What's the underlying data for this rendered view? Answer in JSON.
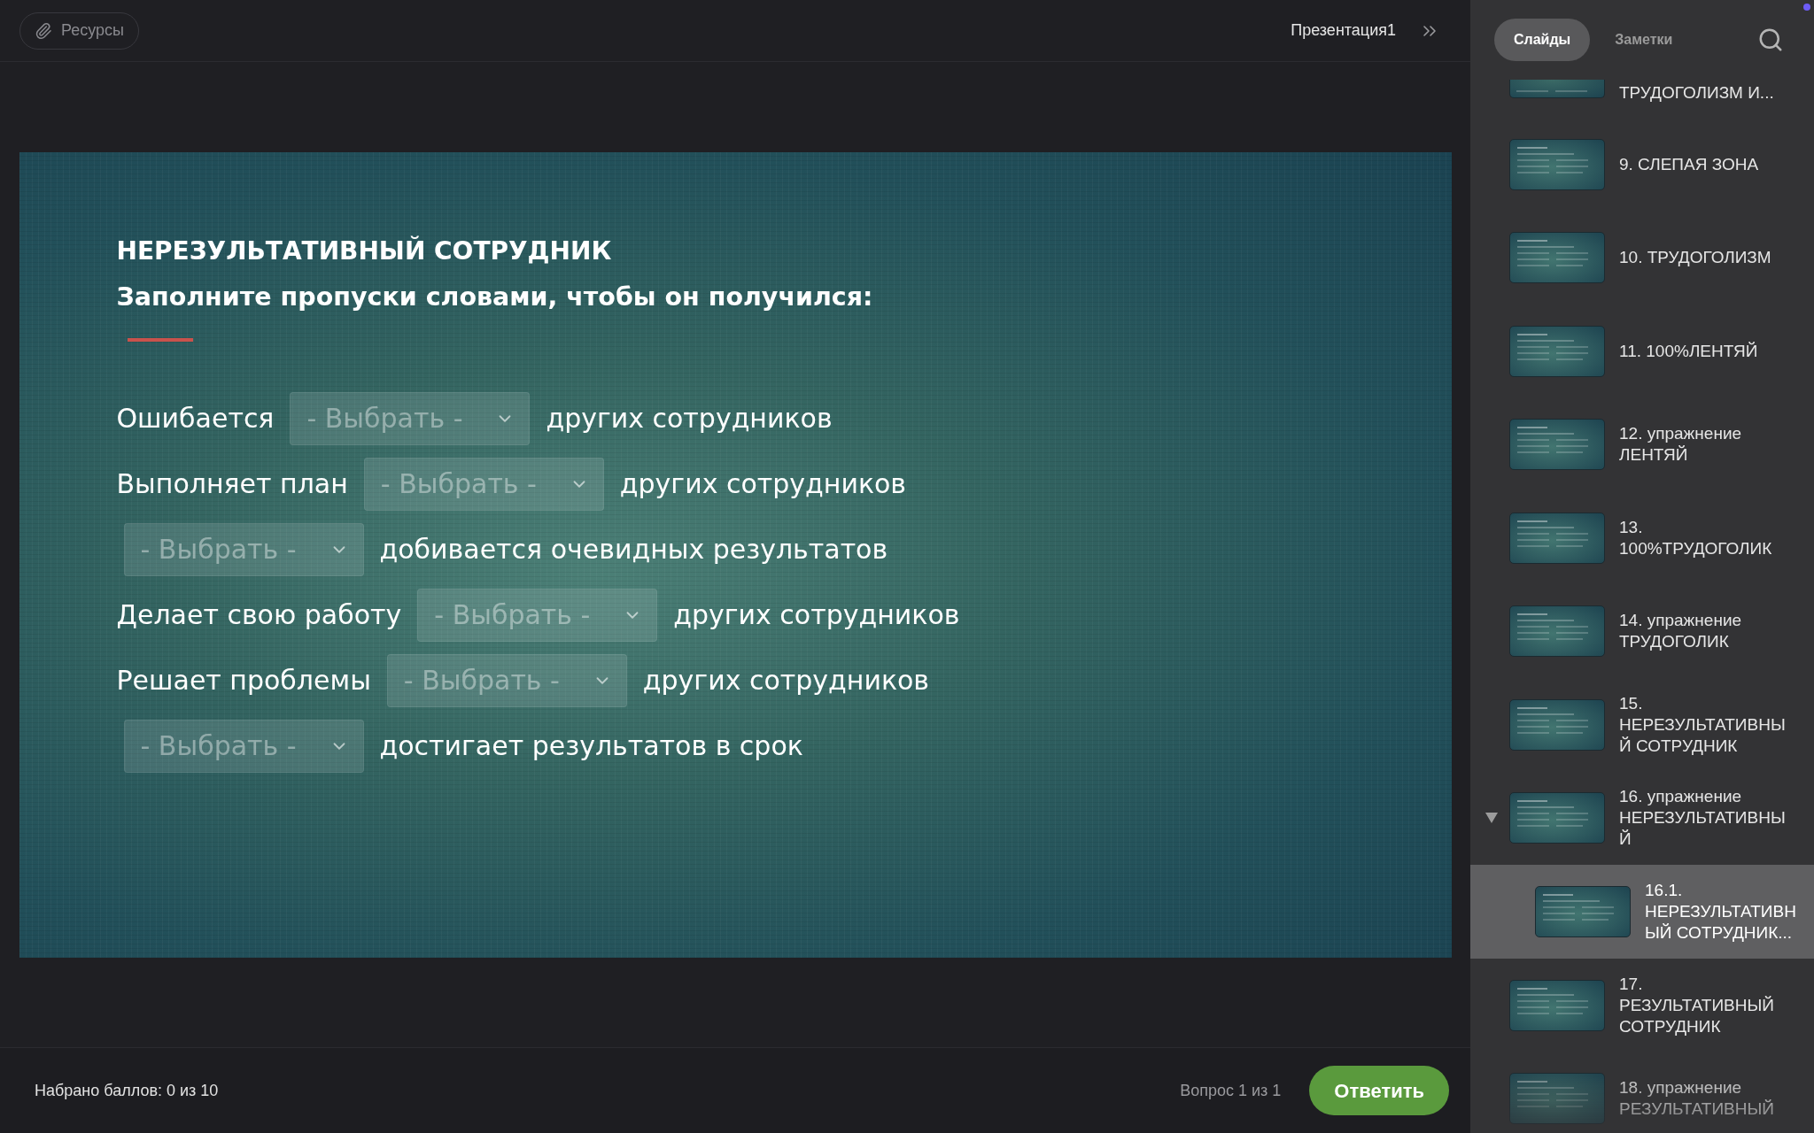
{
  "toolbar": {
    "resources_button": "Ресурсы",
    "presentation_title": "Презентация1"
  },
  "slide": {
    "title": "НЕРЕЗУЛЬТАТИВНЫЙ СОТРУДНИК",
    "subtitle": "Заполните пропуски словами, чтобы он получился:",
    "rows": [
      {
        "parts": [
          {
            "kind": "text",
            "text": "Ошибается"
          },
          {
            "kind": "select",
            "placeholder": "- Выбрать -"
          },
          {
            "kind": "text",
            "text": "других сотрудников"
          }
        ]
      },
      {
        "parts": [
          {
            "kind": "text",
            "text": "Выполняет план"
          },
          {
            "kind": "select",
            "placeholder": "- Выбрать -"
          },
          {
            "kind": "text",
            "text": "других сотрудников"
          }
        ]
      },
      {
        "parts": [
          {
            "kind": "select",
            "placeholder": "- Выбрать -"
          },
          {
            "kind": "text",
            "text": "добивается очевидных результатов"
          }
        ]
      },
      {
        "parts": [
          {
            "kind": "text",
            "text": "Делает свою работу"
          },
          {
            "kind": "select",
            "placeholder": "- Выбрать -"
          },
          {
            "kind": "text",
            "text": "других сотрудников"
          }
        ]
      },
      {
        "parts": [
          {
            "kind": "text",
            "text": "Решает проблемы"
          },
          {
            "kind": "select",
            "placeholder": "- Выбрать -"
          },
          {
            "kind": "text",
            "text": "других сотрудников"
          }
        ]
      },
      {
        "parts": [
          {
            "kind": "select",
            "placeholder": "- Выбрать -"
          },
          {
            "kind": "text",
            "text": "достигает результатов в срок"
          }
        ]
      }
    ]
  },
  "footer": {
    "score": "Набрано баллов: 0 из 10",
    "question_counter": "Вопрос 1 из 1",
    "submit_button": "Ответить"
  },
  "sidebar": {
    "tabs": [
      {
        "label": "Слайды",
        "selected": true
      },
      {
        "label": "Заметки",
        "selected": false
      }
    ],
    "slides": [
      {
        "kind": "clipped",
        "title": "ТРУДОГОЛИЗМ И...",
        "selected": false
      },
      {
        "kind": "slide",
        "title": "9. СЛЕПАЯ ЗОНА",
        "selected": false
      },
      {
        "kind": "slide",
        "title": "10. ТРУДОГОЛИЗМ",
        "selected": false
      },
      {
        "kind": "slide",
        "title": "11. 100%ЛЕНТЯЙ",
        "selected": false
      },
      {
        "kind": "slide",
        "title": "12. упражнение ЛЕНТЯЙ",
        "selected": false
      },
      {
        "kind": "slide",
        "title": "13. 100%ТРУДОГОЛИК",
        "selected": false
      },
      {
        "kind": "slide",
        "title": "14. упражнение ТРУДОГОЛИК",
        "selected": false
      },
      {
        "kind": "slide",
        "title": "15. НЕРЕЗУЛЬТАТИВНЫЙ СОТРУДНИК",
        "selected": false
      },
      {
        "kind": "slide",
        "title": "16. упражнение НЕРЕЗУЛЬТАТИВНЫЙ",
        "selected": false,
        "expanded": true,
        "children": [
          {
            "kind": "slide",
            "title": "16.1. НЕРЕЗУЛЬТАТИВНЫЙ СОТРУДНИК...",
            "selected": true
          }
        ]
      },
      {
        "kind": "slide",
        "title": "17. РЕЗУЛЬТАТИВНЫЙ СОТРУДНИК",
        "selected": false
      },
      {
        "kind": "slide",
        "title": "18. упражнение РЕЗУЛЬТАТИВНЫЙ",
        "selected": false
      }
    ]
  }
}
